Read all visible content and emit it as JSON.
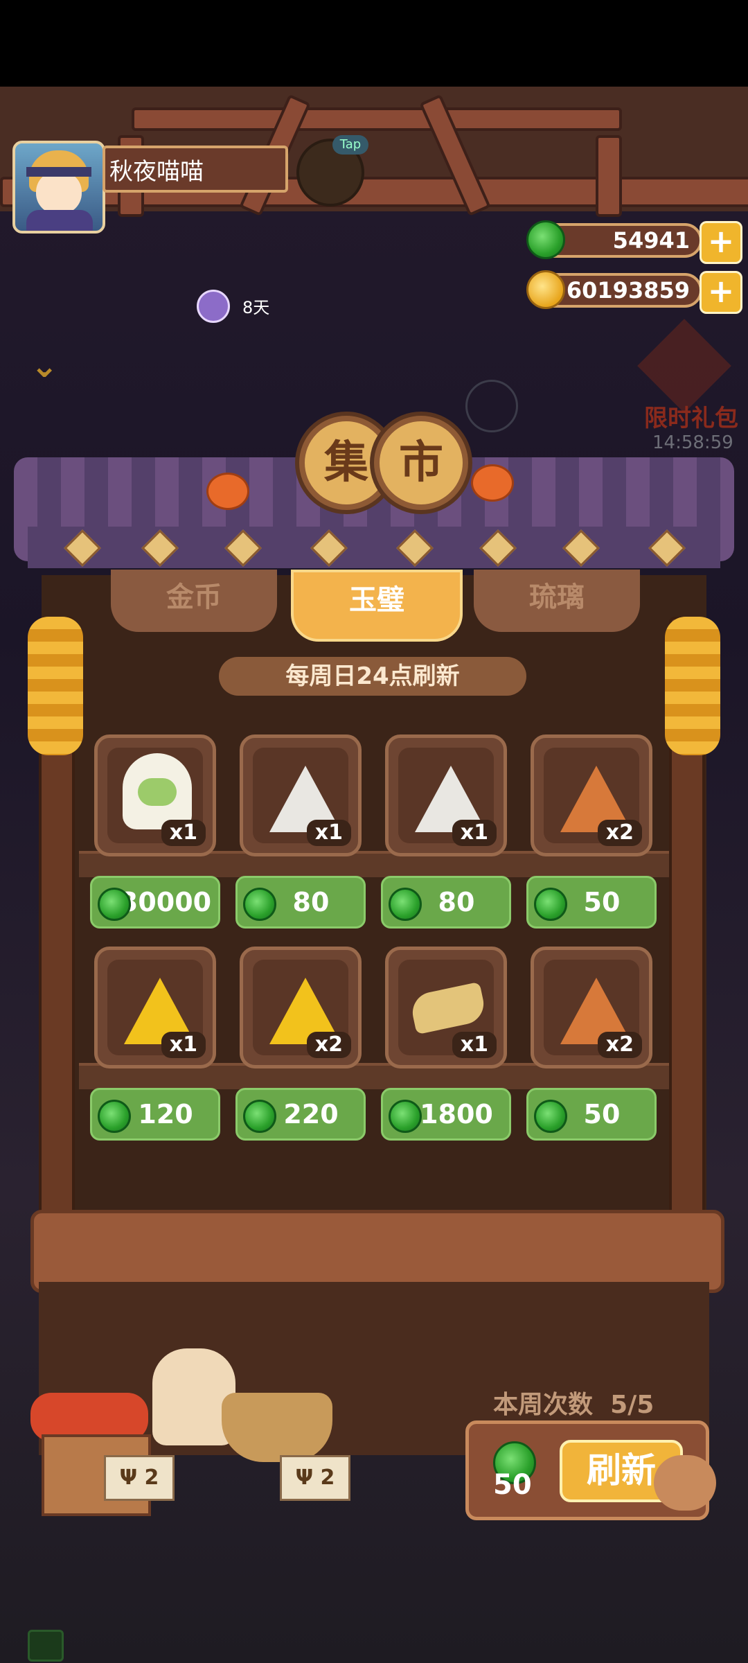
{
  "player": {
    "name": "秋夜喵喵",
    "days": "8天"
  },
  "tap_badge": "Tap",
  "currency": {
    "jade": "54941",
    "coin": "60193859",
    "plus_icon": "+"
  },
  "gift": {
    "label": "限时礼包",
    "timer": "14:58:59"
  },
  "sign": [
    "集",
    "市"
  ],
  "tabs": [
    {
      "label": "金币",
      "active": false
    },
    {
      "label": "玉璧",
      "active": true
    },
    {
      "label": "琉璃",
      "active": false
    }
  ],
  "refresh_note": "每周日24点刷新",
  "items": [
    {
      "icon": "character-doll-icon",
      "qty": "x1",
      "price": "30000"
    },
    {
      "icon": "white-bug-token-icon",
      "qty": "x1",
      "price": "80"
    },
    {
      "icon": "white-rune-token-icon",
      "qty": "x1",
      "price": "80"
    },
    {
      "icon": "orange-rune-token-icon",
      "qty": "x2",
      "price": "50"
    },
    {
      "icon": "gold-rune-token-icon",
      "qty": "x1",
      "price": "120"
    },
    {
      "icon": "gold-bug-token-icon",
      "qty": "x2",
      "price": "220"
    },
    {
      "icon": "shoes-icon",
      "qty": "x1",
      "price": "1800"
    },
    {
      "icon": "orange-flower-token-icon",
      "qty": "x2",
      "price": "50"
    }
  ],
  "weekly": {
    "label": "本周次数",
    "count": "5/5"
  },
  "refresh": {
    "cost": "50",
    "label": "刷新"
  },
  "crate_labels": [
    "Ψ 2",
    "Ψ 2"
  ],
  "colors": {
    "jade": "#2aa02a",
    "gold": "#f1b43a",
    "wood": "#6a3a24"
  }
}
